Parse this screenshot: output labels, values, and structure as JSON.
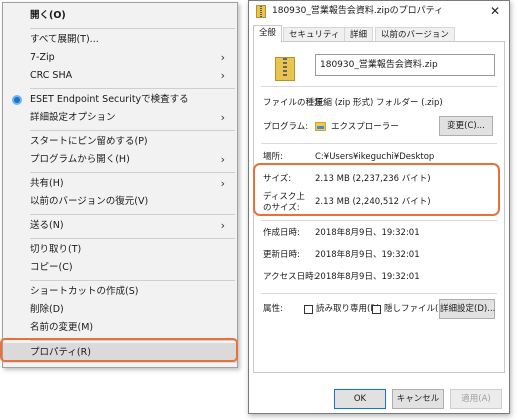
{
  "context_menu": {
    "items": [
      {
        "label": "開く(O)",
        "bold": true
      },
      {
        "label": "すべて展開(T)..."
      },
      {
        "label": "7-Zip",
        "submenu": true
      },
      {
        "label": "CRC SHA",
        "submenu": true
      },
      {
        "label": "ESET Endpoint Securityで検査する",
        "icon": "eset-icon"
      },
      {
        "label": "詳細設定オプション",
        "submenu": true
      },
      {
        "label": "スタートにピン留めする(P)"
      },
      {
        "label": "プログラムから開く(H)",
        "submenu": true
      },
      {
        "label": "共有(H)",
        "submenu": true
      },
      {
        "label": "以前のバージョンの復元(V)"
      },
      {
        "label": "送る(N)",
        "submenu": true
      },
      {
        "label": "切り取り(T)"
      },
      {
        "label": "コピー(C)"
      },
      {
        "label": "ショートカットの作成(S)"
      },
      {
        "label": "削除(D)"
      },
      {
        "label": "名前の変更(M)"
      },
      {
        "label": "プロパティ(R)",
        "highlighted": true
      }
    ],
    "submenu_arrow": "›"
  },
  "dialog": {
    "title": "180930_営業報告会資料.zipのプロパティ",
    "close_glyph": "✕",
    "tabs": [
      {
        "label": "全般",
        "active": true
      },
      {
        "label": "セキュリティ"
      },
      {
        "label": "詳細"
      },
      {
        "label": "以前のバージョン"
      }
    ],
    "file_name": "180930_営業報告会資料.zip",
    "file_type_label": "ファイルの種類:",
    "file_type_value": "圧縮 (zip 形式) フォルダー (.zip)",
    "program_label": "プログラム:",
    "program_value": "エクスプローラー",
    "change_button": "変更(C)...",
    "location_label": "場所:",
    "location_value": "C:¥Users¥ikeguchi¥Desktop",
    "size_label": "サイズ:",
    "size_value": "2.13 MB (2,237,236 バイト)",
    "disk_size_label_1": "ディスク上",
    "disk_size_label_2": "のサイズ:",
    "disk_size_value": "2.13 MB (2,240,512 バイト)",
    "created_label": "作成日時:",
    "created_value": "2018年8月9日、19:32:01",
    "modified_label": "更新日時:",
    "modified_value": "2018年8月9日、19:32:01",
    "accessed_label": "アクセス日時:",
    "accessed_value": "2018年8月9日、19:32:01",
    "attributes_label": "属性:",
    "readonly_label": "読み取り専用(R)",
    "hidden_label": "隠しファイル(H)",
    "advanced_button": "詳細設定(D)...",
    "ok_button": "OK",
    "cancel_button": "キャンセル",
    "apply_button": "適用(A)"
  },
  "colors": {
    "highlight_outline": "#e8703a",
    "menu_bg": "#f2f2f2",
    "accent": "#1a73c8"
  }
}
